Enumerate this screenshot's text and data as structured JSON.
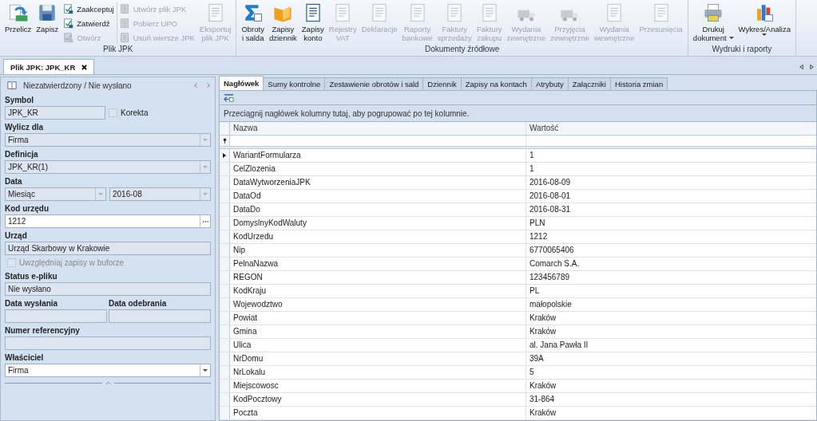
{
  "ribbon": {
    "groups": [
      {
        "label": "Plik JPK",
        "items": [
          {
            "kind": "large",
            "lines": [
              "Przelicz"
            ],
            "disabled": false
          },
          {
            "kind": "large",
            "lines": [
              "Zapisz"
            ],
            "disabled": false
          },
          {
            "kind": "stack",
            "items": [
              {
                "label": "Zaakceptuj",
                "disabled": false
              },
              {
                "label": "Zatwierdź",
                "disabled": false
              },
              {
                "label": "Otwórz",
                "disabled": true
              }
            ]
          },
          {
            "kind": "stack",
            "items": [
              {
                "label": "Utwórz plik JPK",
                "disabled": true
              },
              {
                "label": "Pobierz UPO",
                "disabled": true
              },
              {
                "label": "Usuń wiersze JPK",
                "disabled": true
              }
            ]
          },
          {
            "kind": "large",
            "lines": [
              "Eksportuj",
              "plik JPK"
            ],
            "disabled": true
          }
        ]
      },
      {
        "label": "Dokumenty źródłowe",
        "items": [
          {
            "kind": "large",
            "lines": [
              "Obroty",
              "i salda"
            ],
            "disabled": false
          },
          {
            "kind": "large",
            "lines": [
              "Zapisy",
              "dziennik"
            ],
            "disabled": false
          },
          {
            "kind": "large",
            "lines": [
              "Zapisy",
              "konto"
            ],
            "disabled": false
          },
          {
            "kind": "large",
            "lines": [
              "Rejestry",
              "VAT"
            ],
            "disabled": true
          },
          {
            "kind": "large",
            "lines": [
              "Deklaracje"
            ],
            "disabled": true
          },
          {
            "kind": "large",
            "lines": [
              "Raporty",
              "bankowe"
            ],
            "disabled": true
          },
          {
            "kind": "large",
            "lines": [
              "Faktury",
              "sprzedaży"
            ],
            "disabled": true
          },
          {
            "kind": "large",
            "lines": [
              "Faktury",
              "zakupu"
            ],
            "disabled": true
          },
          {
            "kind": "large",
            "lines": [
              "Wydania",
              "zewnętrzne"
            ],
            "disabled": true
          },
          {
            "kind": "large",
            "lines": [
              "Przyjęcia",
              "zewnętrzne"
            ],
            "disabled": true
          },
          {
            "kind": "large",
            "lines": [
              "Wydania",
              "wewnętrzne"
            ],
            "disabled": true
          },
          {
            "kind": "large",
            "lines": [
              "Przesunięcia"
            ],
            "disabled": true
          }
        ]
      },
      {
        "label": "Wydruki i raporty",
        "items": [
          {
            "kind": "large",
            "lines": [
              "Drukuj",
              "dokument"
            ],
            "disabled": false,
            "dropdown": true
          },
          {
            "kind": "large",
            "lines": [
              "Wykres/Analiza"
            ],
            "disabled": false,
            "dropdown": true
          }
        ]
      }
    ]
  },
  "doc_tabs": [
    {
      "label": "Plik JPK: JPK_KR",
      "selected": true
    }
  ],
  "left_panel": {
    "status": "Niezatwierdzony / Nie wysłano",
    "fields": [
      {
        "kind": "field",
        "label": "Symbol",
        "value": "JPK_KR",
        "editable": false,
        "check": {
          "label": "Korekta",
          "checked": false,
          "disabled": true
        }
      },
      {
        "kind": "combo",
        "label": "Wylicz dla",
        "value": "Firma",
        "editable": false
      },
      {
        "kind": "combo",
        "label": "Definicja",
        "value": "JPK_KR(1)",
        "editable": false
      },
      {
        "kind": "combo_pair",
        "label": "Data",
        "values": [
          "Miesiąc",
          "2016-08"
        ],
        "editable": false
      },
      {
        "kind": "lookup",
        "label": "Kod urzędu",
        "value": "1212",
        "editable": true
      },
      {
        "kind": "field",
        "label": "Urząd",
        "value": "Urząd Skarbowy w Krakowie",
        "editable": false
      },
      {
        "kind": "check",
        "label": "Uwzględniaj zapisy w buforze",
        "checked": false,
        "disabled": true
      },
      {
        "kind": "field",
        "label": "Status e-pliku",
        "value": "Nie wysłano",
        "editable": false
      },
      {
        "kind": "field_pair",
        "labels": [
          "Data wysłania",
          "Data odebrania"
        ],
        "editable": false
      },
      {
        "kind": "field",
        "label": "Numer referencyjny",
        "editable": false
      },
      {
        "kind": "combo",
        "label": "Właściciel",
        "value": "Firma",
        "editable": true
      }
    ]
  },
  "tabs": [
    {
      "label": "Nagłówek",
      "selected": true
    },
    {
      "label": "Sumy kontrolne",
      "selected": false
    },
    {
      "label": "Zestawienie obrotów i sald",
      "selected": false
    },
    {
      "label": "Dziennik",
      "selected": false
    },
    {
      "label": "Zapisy na kontach",
      "selected": false
    },
    {
      "label": "Atrybuty",
      "selected": false
    },
    {
      "label": "Załączniki",
      "selected": false
    },
    {
      "label": "Historia zmian",
      "selected": false
    }
  ],
  "grid": {
    "group_hint": "Przeciągnij nagłówek kolumny tutaj, aby pogrupować po tej kolumnie.",
    "columns": [
      "Nazwa",
      "Wartość"
    ],
    "rows": [
      {
        "name": "WariantFormularza",
        "value": "1",
        "current": true
      },
      {
        "name": "CelZlozenia",
        "value": "1",
        "current": false
      },
      {
        "name": "DataWytworzeniaJPK",
        "value": "2016-08-09",
        "current": false
      },
      {
        "name": "DataOd",
        "value": "2016-08-01",
        "current": false
      },
      {
        "name": "DataDo",
        "value": "2016-08-31",
        "current": false
      },
      {
        "name": "DomyslnyKodWaluty",
        "value": "PLN",
        "current": false
      },
      {
        "name": "KodUrzedu",
        "value": "1212",
        "current": false
      },
      {
        "name": "Nip",
        "value": "6770065406",
        "current": false
      },
      {
        "name": "PelnaNazwa",
        "value": "Comarch S.A.",
        "current": false
      },
      {
        "name": "REGON",
        "value": "123456789",
        "current": false
      },
      {
        "name": "KodKraju",
        "value": "PL",
        "current": false
      },
      {
        "name": "Wojewodztwo",
        "value": "małopolskie",
        "current": false
      },
      {
        "name": "Powiat",
        "value": "Kraków",
        "current": false
      },
      {
        "name": "Gmina",
        "value": "Kraków",
        "current": false
      },
      {
        "name": "Ulica",
        "value": "al. Jana Pawła II",
        "current": false
      },
      {
        "name": "NrDomu",
        "value": "39A",
        "current": false
      },
      {
        "name": "NrLokalu",
        "value": "5",
        "current": false
      },
      {
        "name": "Miejscowosc",
        "value": "Kraków",
        "current": false
      },
      {
        "name": "KodPocztowy",
        "value": "31-864",
        "current": false
      },
      {
        "name": "Poczta",
        "value": "Kraków",
        "current": false
      }
    ]
  }
}
